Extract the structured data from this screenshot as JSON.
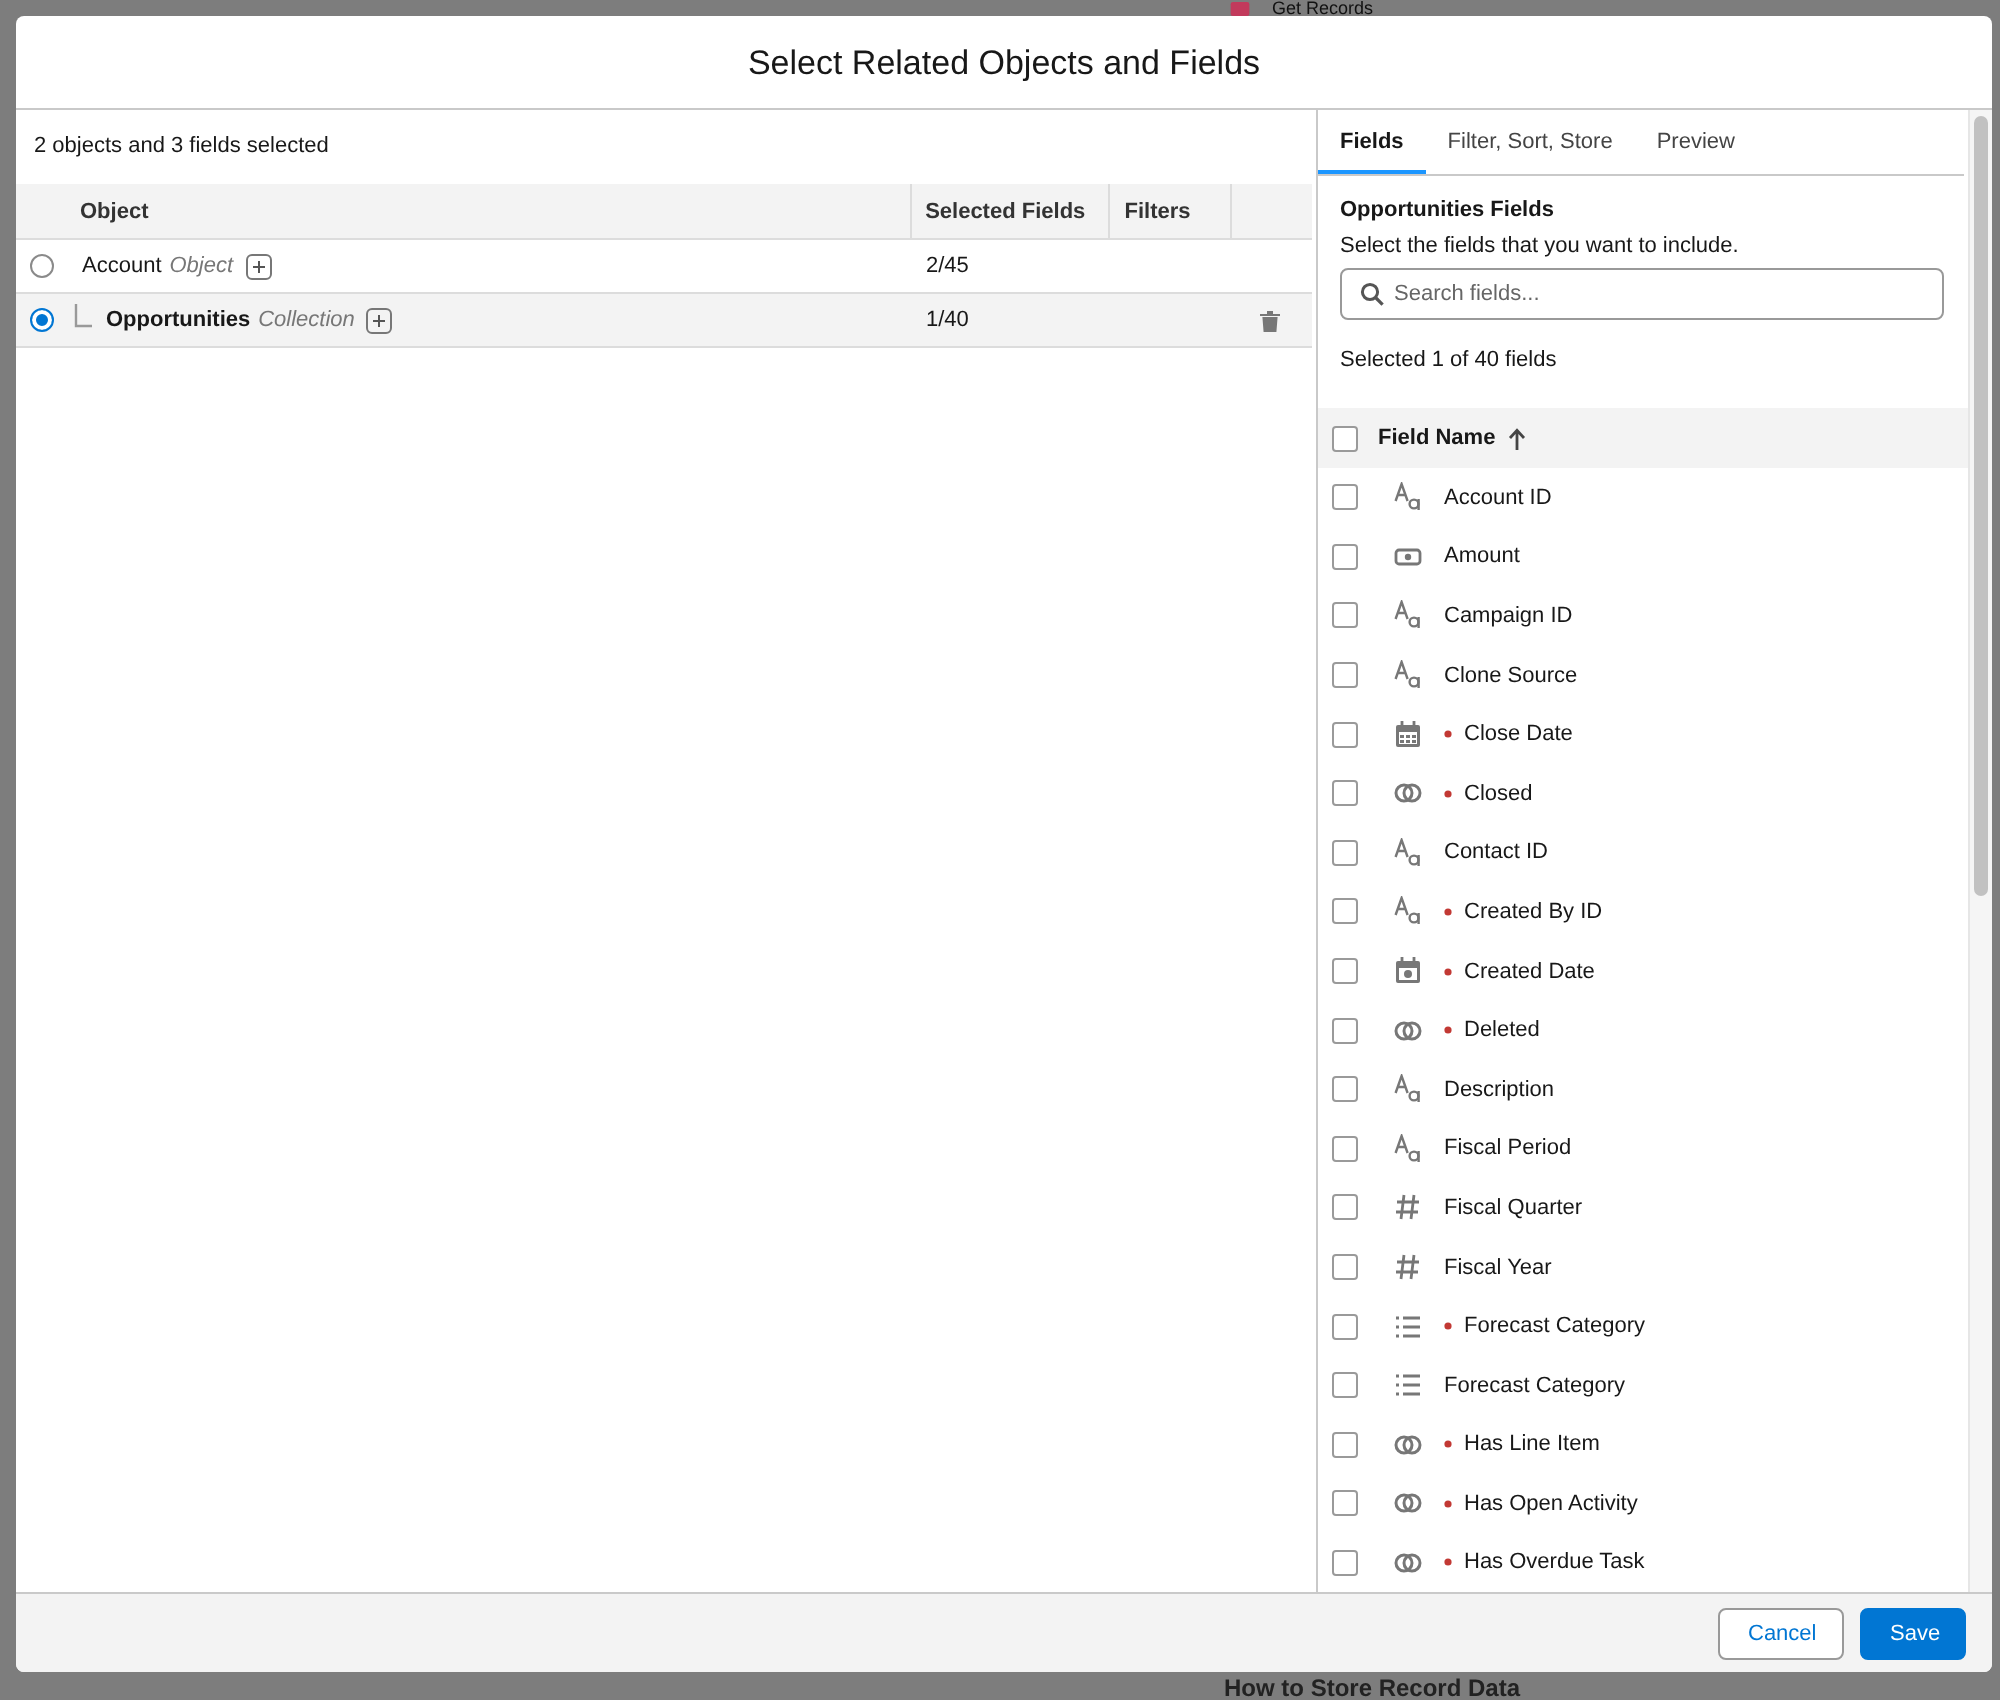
{
  "background": {
    "title": "Get Records",
    "heading": "How to Store Record Data"
  },
  "modal": {
    "title": "Select Related Objects and Fields",
    "summary": "2 objects and 3 fields selected",
    "objects": {
      "columns": [
        "Object",
        "Selected Fields",
        "Filters"
      ],
      "rows": [
        {
          "name": "Account",
          "type": "Object",
          "selected": false,
          "selected_fields": "2/45",
          "deletable": false,
          "children": [
            {
              "name": "Opportunities",
              "type": "Collection",
              "selected": true,
              "selected_fields": "1/40",
              "deletable": true
            }
          ]
        }
      ]
    },
    "tabs": [
      {
        "label": "Fields",
        "selected": true
      },
      {
        "label": "Filter, Sort, Store",
        "selected": false
      },
      {
        "label": "Preview",
        "selected": false
      }
    ],
    "fields_panel": {
      "title": "Opportunities Fields",
      "instructions": "Select the fields that you want to include.",
      "search": {
        "placeholder": "Search fields..."
      },
      "count": "Selected 1 of 40 fields",
      "header": {
        "label": "Field Name",
        "checked": false
      },
      "fields": [
        {
          "name": "Account ID",
          "kind": "text",
          "required": false,
          "checked": false
        },
        {
          "name": "Amount",
          "kind": "currency",
          "required": false,
          "checked": false
        },
        {
          "name": "Campaign ID",
          "kind": "text",
          "required": false,
          "checked": false
        },
        {
          "name": "Clone Source",
          "kind": "text",
          "required": false,
          "checked": false
        },
        {
          "name": "Close Date",
          "kind": "date",
          "required": true,
          "checked": false
        },
        {
          "name": "Closed",
          "kind": "boolean",
          "required": true,
          "checked": false
        },
        {
          "name": "Contact ID",
          "kind": "text",
          "required": false,
          "checked": false
        },
        {
          "name": "Created By ID",
          "kind": "text",
          "required": true,
          "checked": false
        },
        {
          "name": "Created Date",
          "kind": "datetime",
          "required": true,
          "checked": false
        },
        {
          "name": "Deleted",
          "kind": "boolean",
          "required": true,
          "checked": false
        },
        {
          "name": "Description",
          "kind": "text",
          "required": false,
          "checked": false
        },
        {
          "name": "Fiscal Period",
          "kind": "text",
          "required": false,
          "checked": false
        },
        {
          "name": "Fiscal Quarter",
          "kind": "number",
          "required": false,
          "checked": false
        },
        {
          "name": "Fiscal Year",
          "kind": "number",
          "required": false,
          "checked": false
        },
        {
          "name": "Forecast Category",
          "kind": "picklist",
          "required": true,
          "checked": false
        },
        {
          "name": "Forecast Category",
          "kind": "picklist",
          "required": false,
          "checked": false
        },
        {
          "name": "Has Line Item",
          "kind": "boolean",
          "required": true,
          "checked": false
        },
        {
          "name": "Has Open Activity",
          "kind": "boolean",
          "required": true,
          "checked": false
        },
        {
          "name": "Has Overdue Task",
          "kind": "boolean",
          "required": true,
          "checked": false
        }
      ]
    },
    "buttons": [
      {
        "label": "Cancel",
        "kind": "neutral"
      },
      {
        "label": "Save",
        "kind": "brand"
      }
    ]
  }
}
